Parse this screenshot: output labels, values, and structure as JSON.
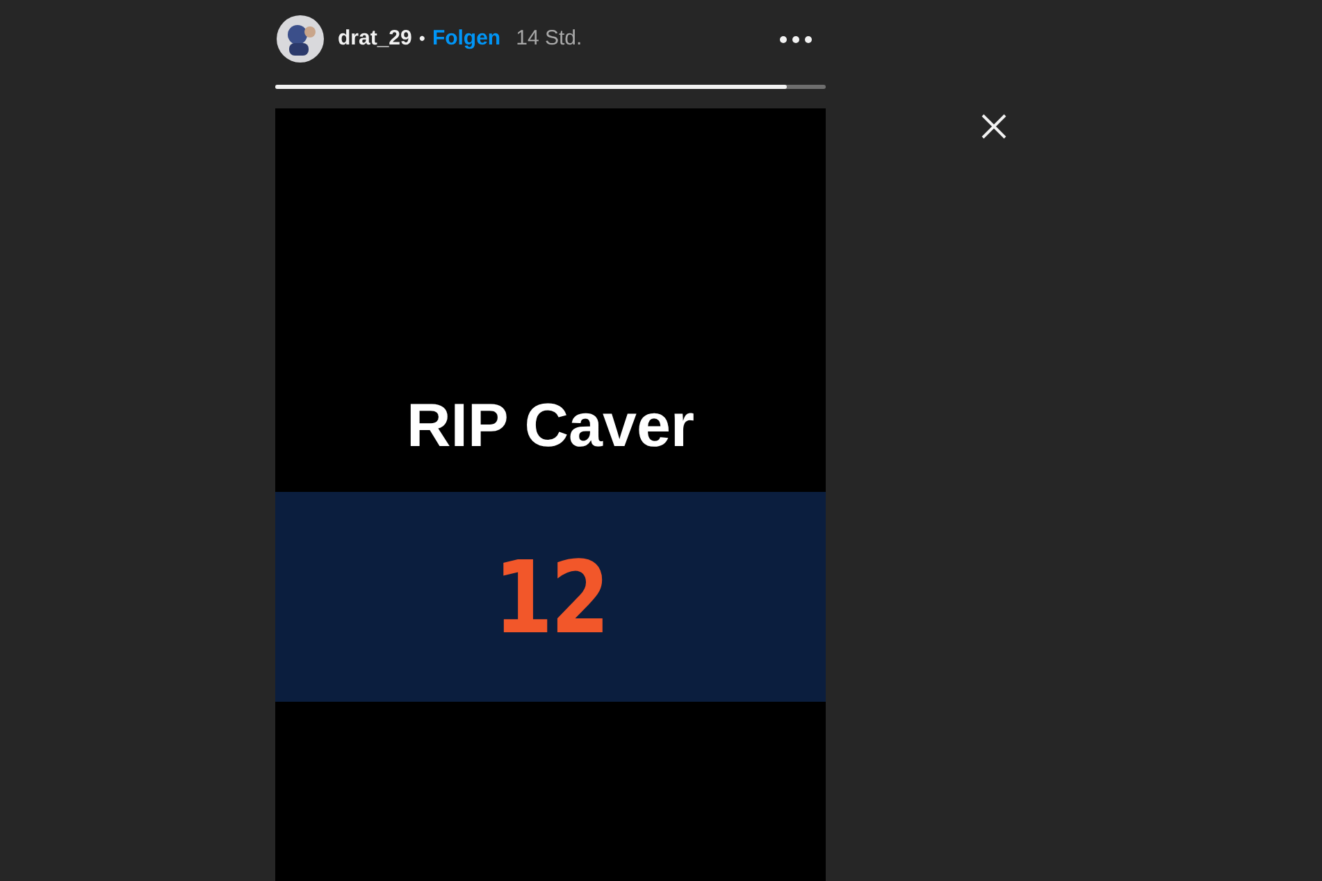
{
  "header": {
    "username": "drat_29",
    "separator": "•",
    "follow": "Folgen",
    "time": "14 Std."
  },
  "progress": {
    "level": 0.93
  },
  "story": {
    "title": "RIP Caver",
    "number": "12"
  }
}
